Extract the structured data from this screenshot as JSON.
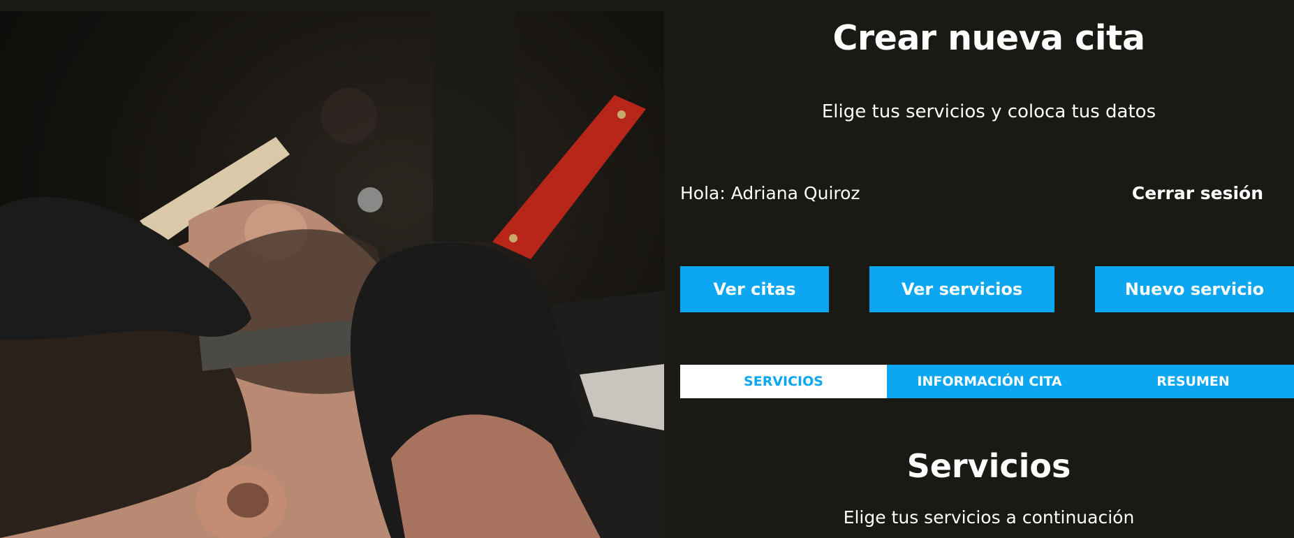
{
  "header": {
    "title": "Crear nueva cita",
    "subtitle": "Elige tus servicios y coloca tus datos"
  },
  "session": {
    "greeting": "Hola: Adriana Quiroz",
    "logout_label": "Cerrar sesión"
  },
  "actions": {
    "view_appointments": "Ver citas",
    "view_services": "Ver servicios",
    "new_service": "Nuevo servicio"
  },
  "tabs": [
    {
      "label": "SERVICIOS",
      "active": true
    },
    {
      "label": "INFORMACIÓN CITA",
      "active": false
    },
    {
      "label": "RESUMEN",
      "active": false
    }
  ],
  "section": {
    "title": "Servicios",
    "subtitle": "Elige tus servicios a continuación"
  },
  "colors": {
    "background": "#1a1914",
    "accent": "#0da6f0",
    "text": "#ffffff"
  },
  "hero_image": "barber-shaving-customer-photo"
}
